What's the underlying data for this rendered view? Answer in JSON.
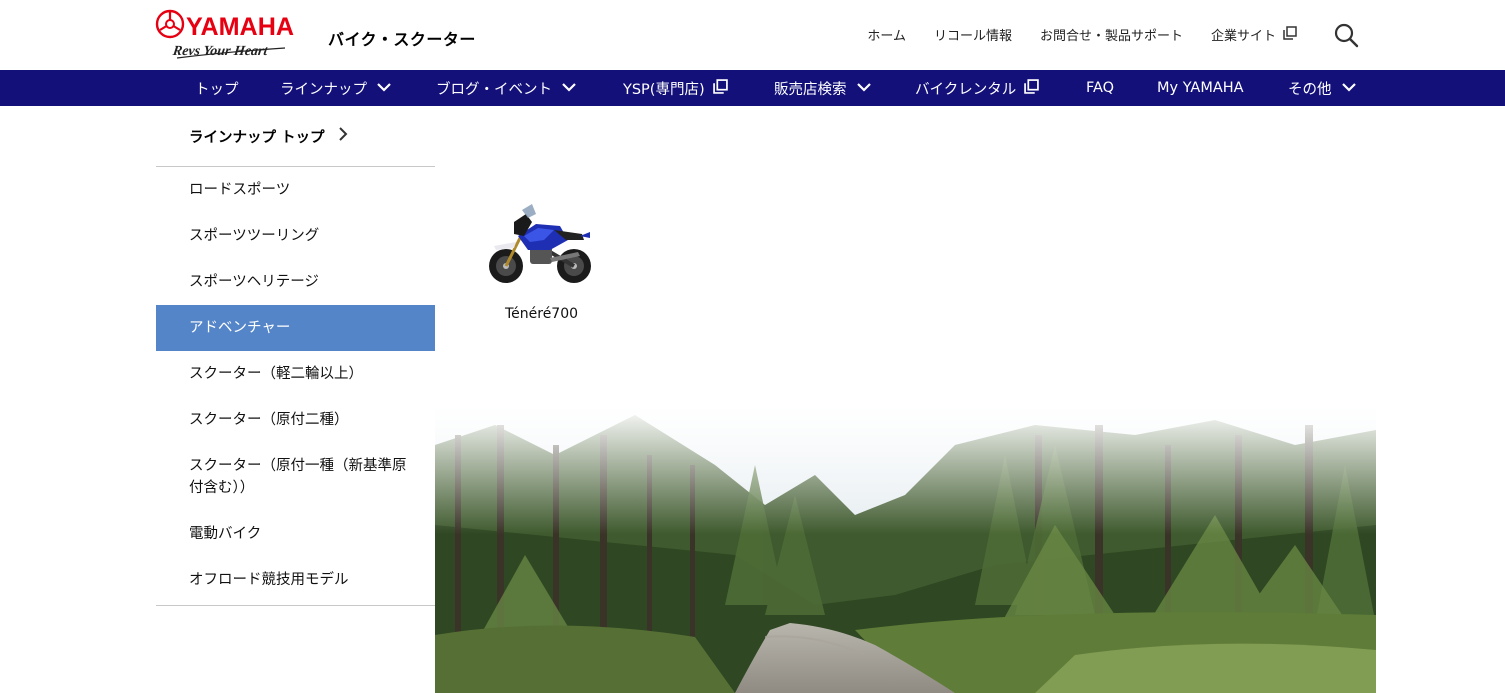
{
  "header": {
    "logo_text": "YAMAHA",
    "logo_tagline": "Revs Your Heart",
    "site_title": "バイク・スクーター",
    "util_links": [
      {
        "label": "ホーム",
        "external": false
      },
      {
        "label": "リコール情報",
        "external": false
      },
      {
        "label": "お問合せ・製品サポート",
        "external": false
      },
      {
        "label": "企業サイト",
        "external": true
      }
    ],
    "search_icon": "search-icon"
  },
  "gnav": {
    "items": [
      {
        "label": "トップ",
        "icon": ""
      },
      {
        "label": "ラインナップ",
        "icon": "chevron-down-icon"
      },
      {
        "label": "ブログ・イベント",
        "icon": "chevron-down-icon"
      },
      {
        "label": "YSP(専門店)",
        "icon": "external-link-icon"
      },
      {
        "label": "販売店検索",
        "icon": "chevron-down-icon"
      },
      {
        "label": "バイクレンタル",
        "icon": "external-link-icon"
      },
      {
        "label": "FAQ",
        "icon": ""
      },
      {
        "label": "My YAMAHA",
        "icon": ""
      },
      {
        "label": "その他",
        "icon": "chevron-down-icon"
      }
    ]
  },
  "sidebar": {
    "top_label": "ラインナップ トップ",
    "items": [
      {
        "label": "ロードスポーツ",
        "active": false
      },
      {
        "label": "スポーツツーリング",
        "active": false
      },
      {
        "label": "スポーツヘリテージ",
        "active": false
      },
      {
        "label": "アドベンチャー",
        "active": true
      },
      {
        "label": "スクーター（軽二輪以上）",
        "active": false
      },
      {
        "label": "スクーター（原付二種）",
        "active": false
      },
      {
        "label": "スクーター（原付一種（新基準原付含む））",
        "active": false
      },
      {
        "label": "電動バイク",
        "active": false
      },
      {
        "label": "オフロード競技用モデル",
        "active": false
      }
    ]
  },
  "products": [
    {
      "name": "Ténéré700"
    }
  ],
  "colors": {
    "brand_red": "#e60012",
    "nav_bg": "#13107a",
    "active_bg": "#5585c9"
  }
}
